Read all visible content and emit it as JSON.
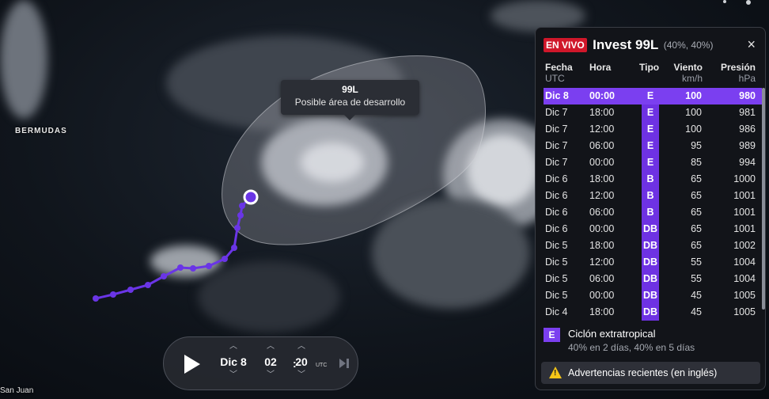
{
  "map": {
    "labels": {
      "bermuda": "BERMUDAS",
      "san_juan": "San Juan"
    },
    "tooltip": {
      "title": "99L",
      "subtitle": "Posible área de desarrollo"
    },
    "colors": {
      "track": "#6a35e6",
      "cone": "#b9bcc2"
    }
  },
  "timebar": {
    "date": "Dic 8",
    "hour": "02",
    "minute": "20",
    "tz": "UTC",
    "separator": ":",
    "up_icon": "chevron-up-icon",
    "down_icon": "chevron-down-icon"
  },
  "panel": {
    "live_badge": "EN VIVO",
    "title": "Invest 99L",
    "probability": "(40%, 40%)",
    "close": "×",
    "columns": {
      "date": "Fecha",
      "date_unit": "UTC",
      "hour": "Hora",
      "type": "Tipo",
      "wind": "Viento",
      "wind_unit": "km/h",
      "pressure": "Presión",
      "pressure_unit": "hPa"
    },
    "rows": [
      {
        "date": "Dic 8",
        "hour": "00:00",
        "type": "E",
        "wind": "100",
        "pressure": "980"
      },
      {
        "date": "Dic 7",
        "hour": "18:00",
        "type": "E",
        "wind": "100",
        "pressure": "981"
      },
      {
        "date": "Dic 7",
        "hour": "12:00",
        "type": "E",
        "wind": "100",
        "pressure": "986"
      },
      {
        "date": "Dic 7",
        "hour": "06:00",
        "type": "E",
        "wind": "95",
        "pressure": "989"
      },
      {
        "date": "Dic 7",
        "hour": "00:00",
        "type": "E",
        "wind": "85",
        "pressure": "994"
      },
      {
        "date": "Dic 6",
        "hour": "18:00",
        "type": "B",
        "wind": "65",
        "pressure": "1000"
      },
      {
        "date": "Dic 6",
        "hour": "12:00",
        "type": "B",
        "wind": "65",
        "pressure": "1001"
      },
      {
        "date": "Dic 6",
        "hour": "06:00",
        "type": "B",
        "wind": "65",
        "pressure": "1001"
      },
      {
        "date": "Dic 6",
        "hour": "00:00",
        "type": "DB",
        "wind": "65",
        "pressure": "1001"
      },
      {
        "date": "Dic 5",
        "hour": "18:00",
        "type": "DB",
        "wind": "65",
        "pressure": "1002"
      },
      {
        "date": "Dic 5",
        "hour": "12:00",
        "type": "DB",
        "wind": "55",
        "pressure": "1004"
      },
      {
        "date": "Dic 5",
        "hour": "06:00",
        "type": "DB",
        "wind": "55",
        "pressure": "1004"
      },
      {
        "date": "Dic 5",
        "hour": "00:00",
        "type": "DB",
        "wind": "45",
        "pressure": "1005"
      },
      {
        "date": "Dic 4",
        "hour": "18:00",
        "type": "DB",
        "wind": "45",
        "pressure": "1005"
      }
    ],
    "legend": {
      "badge": "E",
      "name": "Ciclón extratropical",
      "detail": "40% en 2 días, 40% en 5 días"
    },
    "warning": {
      "icon": "warning-icon",
      "label": "Advertencias recientes (en inglés)"
    },
    "accent": "#7b3ff0",
    "live_color": "#d0172a"
  }
}
